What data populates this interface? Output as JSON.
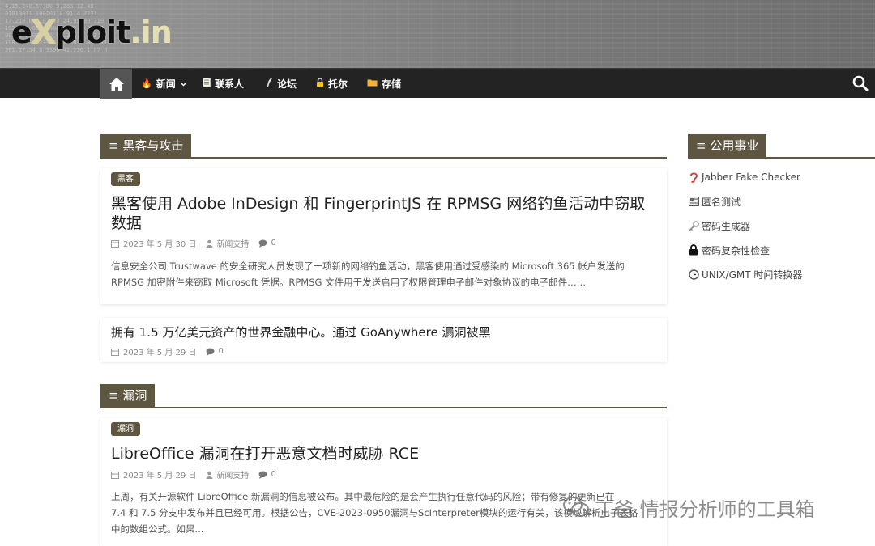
{
  "site": {
    "logo_text_e": "e",
    "logo_text_x": "X",
    "logo_text_rest": "ploit",
    "logo_text_in": ".in"
  },
  "nav": {
    "items": [
      {
        "label": "新闻",
        "icon": "fire-icon"
      },
      {
        "label": "联系人",
        "icon": "document-icon"
      },
      {
        "label": "论坛",
        "icon": "feather-icon"
      },
      {
        "label": "托尔",
        "icon": "lock-icon"
      },
      {
        "label": "存储",
        "icon": "folder-icon"
      }
    ]
  },
  "sections": [
    {
      "label": "≡ 黑客与攻击"
    },
    {
      "label": "≡ 漏洞"
    }
  ],
  "posts": [
    {
      "badge": "黑客",
      "title": "黑客使用 Adobe InDesign 和 FingerprintJS 在 RPMSG 网络钓鱼活动中窃取数据",
      "date": "2023 年 5 月 30 日",
      "author": "新闻支持",
      "comments": "0",
      "excerpt": "信息安全公司 Trustwave 的安全研究人员发现了一项新的网络钓鱼活动，黑客使用通过受感染的 Microsoft 365 帐户发送的 RPMSG 加密附件来窃取 Microsoft 凭据。RPMSG 文件用于发送启用了权限管理电子邮件对象协议的电子邮件……"
    },
    {
      "title": "拥有 1.5 万亿美元资产的世界金融中心。通过 GoAnywhere 漏洞被黑",
      "date": "2023 年 5 月 29 日",
      "comments": "0"
    },
    {
      "badge": "漏洞",
      "title": "LibreOffice 漏洞在打开恶意文档时威胁 RCE",
      "date": "2023 年 5 月 29 日",
      "author": "新闻支持",
      "comments": "0",
      "excerpt_l1": "上周，有关开源软件 LibreOffice 新漏洞的信息被公布。其中最危险的是会产生执行任意代码的风险；带有修复的更新已在",
      "excerpt_l2": "7.4 和 7.5 分支中发布并且已经可用。根据公告，CVE-2023-0950漏洞与ScInterpreter模块的运行有关，该模块解析电子表格",
      "excerpt_l3": "中的数组公式。如果..."
    }
  ],
  "sidebar": {
    "heading": "≡ 公用事业",
    "items": [
      {
        "label": "Jabber Fake Checker",
        "icon": "ear-icon"
      },
      {
        "label": "匿名测试",
        "icon": "id-card-icon"
      },
      {
        "label": "密码生成器",
        "icon": "key-icon"
      },
      {
        "label": "密码复杂性检查",
        "icon": "padlock-icon"
      },
      {
        "label": "UNIX/GMT 时间转换器",
        "icon": "clock-icon"
      }
    ]
  },
  "watermark": {
    "text": "丁爸 情报分析师的工具箱"
  }
}
